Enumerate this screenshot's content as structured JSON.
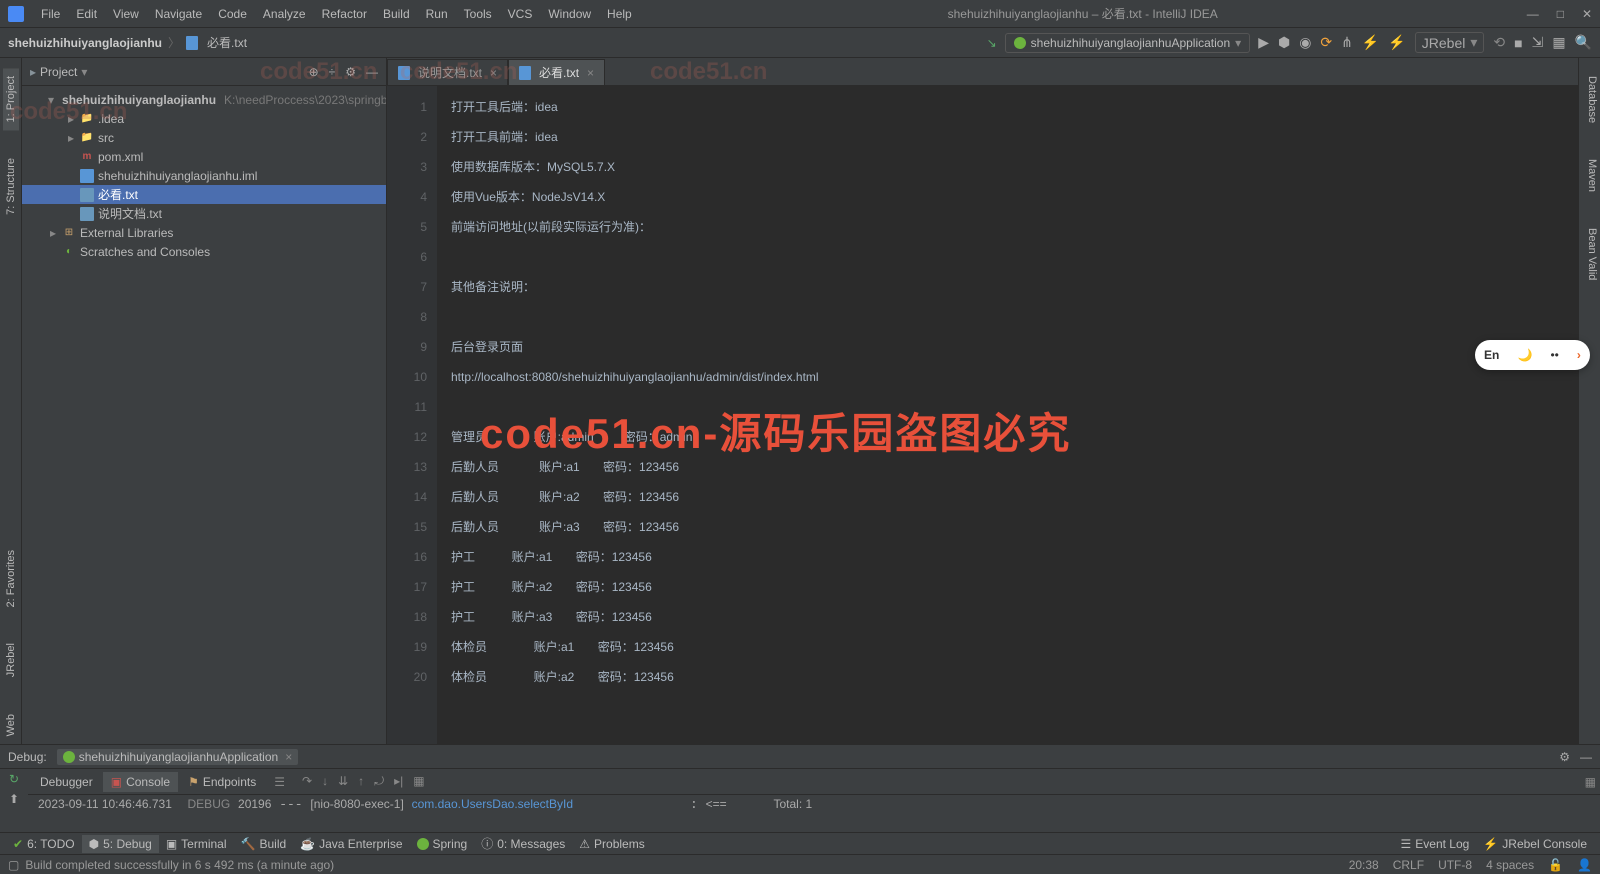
{
  "app": {
    "title": "shehuizhihuiyanglaojianhu – 必看.txt - IntelliJ IDEA"
  },
  "menu": [
    "File",
    "Edit",
    "View",
    "Navigate",
    "Code",
    "Analyze",
    "Refactor",
    "Build",
    "Run",
    "Tools",
    "VCS",
    "Window",
    "Help"
  ],
  "breadcrumb": {
    "project": "shehuizhihuiyanglaojianhu",
    "file": "必看.txt"
  },
  "runConfig": "shehuizhihuiyanglaojianhuApplication",
  "jrebel": "JRebel",
  "projectPanel": {
    "title": "Project",
    "root": {
      "name": "shehuizhihuiyanglaojianhu",
      "hint": "K:\\needProccess\\2023\\springb"
    },
    "items": [
      {
        "name": ".idea",
        "type": "folder"
      },
      {
        "name": "src",
        "type": "folder"
      },
      {
        "name": "pom.xml",
        "type": "m"
      },
      {
        "name": "shehuizhihuiyanglaojianhu.iml",
        "type": "iml"
      },
      {
        "name": "必看.txt",
        "type": "txt",
        "selected": true
      },
      {
        "name": "说明文档.txt",
        "type": "txt"
      }
    ],
    "external": "External Libraries",
    "scratches": "Scratches and Consoles"
  },
  "editorTabs": [
    {
      "label": "说明文档.txt",
      "active": false
    },
    {
      "label": "必看.txt",
      "active": true
    }
  ],
  "lines": [
    "打开工具后端：idea",
    "打开工具前端：idea",
    "使用数据库版本：MySQL5.7.X",
    "使用Vue版本：NodeJsV14.X",
    "前端访问地址(以前段实际运行为准)：",
    "",
    "其他备注说明：",
    "",
    "后台登录页面",
    "http://localhost:8080/shehuizhihuiyanglaojianhu/admin/dist/index.html",
    "",
    "管理员              账户:admin         密码：admin",
    "后勤人员            账户:a1       密码：123456",
    "后勤人员            账户:a2       密码：123456",
    "后勤人员            账户:a3       密码：123456",
    "护工           账户:a1       密码：123456",
    "护工           账户:a2       密码：123456",
    "护工           账户:a3       密码：123456",
    "体检员              账户:a1       密码：123456",
    "体检员              账户:a2       密码：123456"
  ],
  "leftGutter": [
    "1: Project",
    "7: Structure",
    "2: Favorites",
    "JRebel",
    "Web"
  ],
  "rightGutter": [
    "Database",
    "Maven",
    "Bean Valid"
  ],
  "debug": {
    "label": "Debug:",
    "config": "shehuizhihuiyanglaojianhuApplication",
    "tabs": {
      "debugger": "Debugger",
      "console": "Console",
      "endpoints": "Endpoints"
    },
    "logLine": {
      "ts": "2023-09-11 10:46:46.731",
      "level": "DEBUG",
      "pid": "20196",
      "thread": "[nio-8080-exec-1]",
      "cls": "com.dao.UsersDao.selectById",
      "arrow": "<==",
      "total": "Total: 1"
    }
  },
  "bottomTabs": {
    "todo": "6: TODO",
    "debug": "5: Debug",
    "terminal": "Terminal",
    "build": "Build",
    "javaent": "Java Enterprise",
    "spring": "Spring",
    "messages": "0: Messages",
    "problems": "Problems",
    "eventlog": "Event Log",
    "jrebel": "JRebel Console"
  },
  "buildMsg": "Build completed successfully in 6 s 492 ms (a minute ago)",
  "status": {
    "time": "20:38",
    "le": "CRLF",
    "enc": "UTF-8",
    "indent": "4 spaces"
  },
  "ime": "En",
  "watermark": "code51.cn-源码乐园盗图必究",
  "wmLight": "code51.cn"
}
